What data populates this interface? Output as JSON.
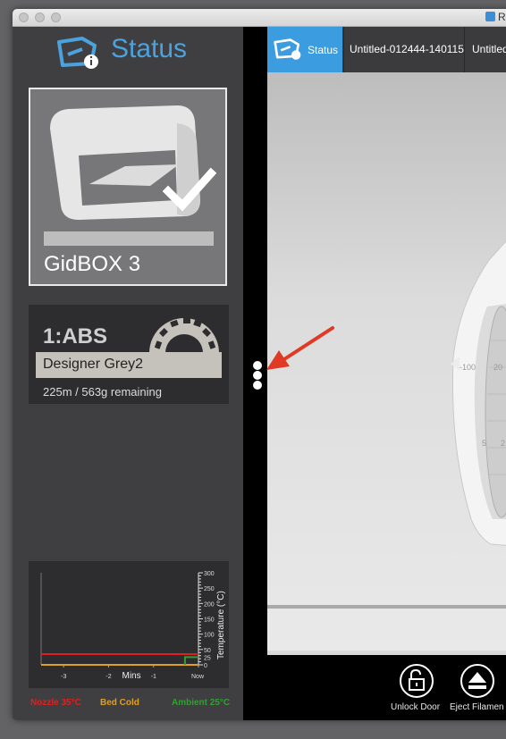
{
  "window": {
    "title": "R"
  },
  "sidebar": {
    "title": "Status",
    "printer": {
      "name": "GidBOX 3",
      "status_icon": "checkmark-icon",
      "progress": 0
    },
    "spool": {
      "id": "1:ABS",
      "color_name": "Designer Grey2",
      "remaining": "225m / 563g remaining"
    },
    "temperature_chart": {
      "legend": {
        "nozzle": "Nozzle 35°C",
        "bed": "Bed Cold",
        "ambient": "Ambient 25°C"
      },
      "colors": {
        "nozzle": "#e02020",
        "bed": "#e0a020",
        "ambient": "#30a030"
      }
    }
  },
  "tabs": [
    {
      "label": "Status",
      "active": true
    },
    {
      "label": "Untitled-012444-140115"
    },
    {
      "label": "Untitled"
    }
  ],
  "viewport": {
    "ruler_labels": [
      "-100",
      "20",
      "5",
      "2"
    ]
  },
  "bottom_bar": {
    "unlock_label": "Unlock Door",
    "eject_label": "Eject Filamen"
  },
  "chart_data": {
    "type": "line",
    "xlabel": "Mins",
    "ylabel": "Temperature (°C)",
    "x_ticks": [
      "-3",
      "-2",
      "-1",
      "Now"
    ],
    "y_ticks": [
      0,
      25,
      50,
      100,
      150,
      200,
      250,
      300
    ],
    "ylim": [
      0,
      300
    ],
    "xlim": [
      -3.5,
      0
    ],
    "series": [
      {
        "name": "Nozzle",
        "x": [
          -3.5,
          -0.2,
          0
        ],
        "y": [
          35,
          35,
          35
        ]
      },
      {
        "name": "Bed",
        "x": [
          -3.5,
          -0.2,
          0
        ],
        "y": [
          0,
          0,
          0
        ]
      },
      {
        "name": "Ambient",
        "x": [
          -0.3,
          -0.3,
          0
        ],
        "y": [
          0,
          25,
          25
        ]
      }
    ]
  }
}
